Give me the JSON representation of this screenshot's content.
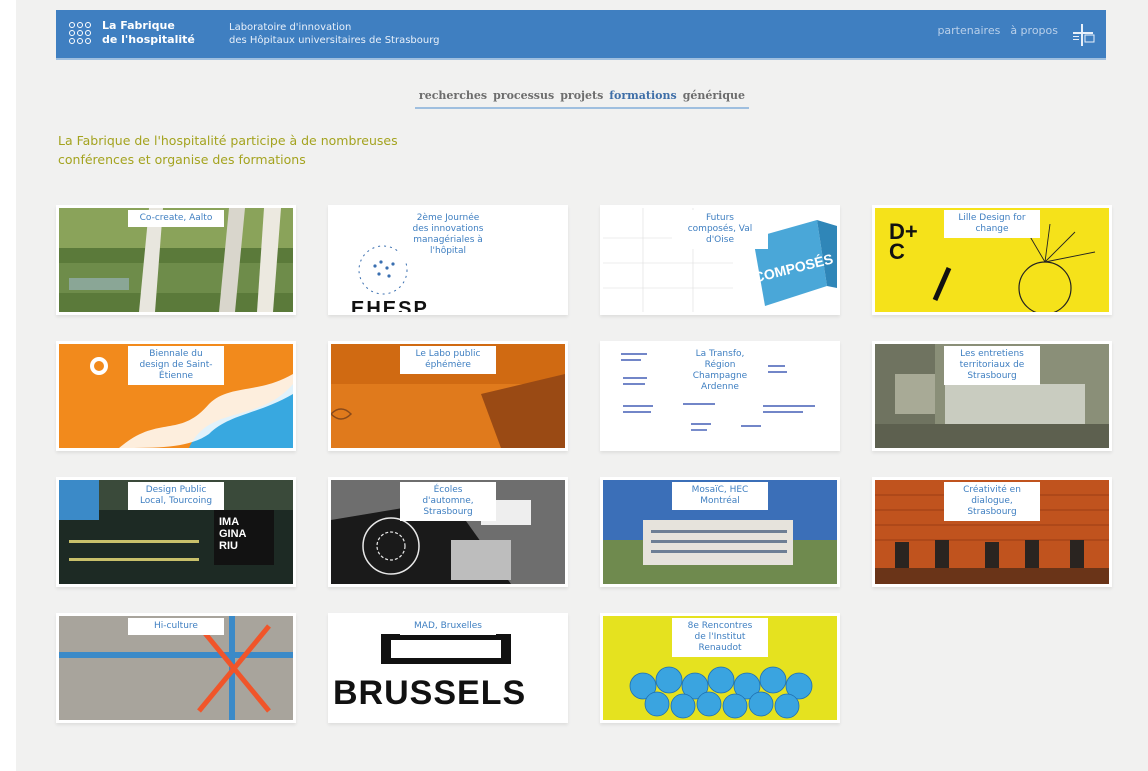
{
  "header": {
    "brand_line1": "La Fabrique",
    "brand_line2": "de l'hospitalité",
    "tagline_line1": "Laboratoire d'innovation",
    "tagline_line2": "des Hôpitaux universitaires de Strasbourg",
    "nav": [
      "partenaires",
      "à propos"
    ],
    "logo_icon": "hus-logo-icon",
    "brand_icon": "fabrique-dots-icon"
  },
  "categories": {
    "items": [
      "recherches",
      "processus",
      "projets",
      "formations",
      "générique"
    ],
    "active": "formations"
  },
  "intro": {
    "line1": "La Fabrique de l'hospitalité participe à de nombreuses",
    "line2": "conférences et organise des formations"
  },
  "cards": [
    {
      "label": "Co-create, Aalto"
    },
    {
      "label": "2ème Journée\ndes innovations\nmanagériales à\nl'hôpital",
      "image_text": "EHESP"
    },
    {
      "label": "Futurs\ncomposés, Val\nd'Oise",
      "image_text": "COMPOSÉS"
    },
    {
      "label": "Lille Design for\nchange",
      "image_text": "D+\nC"
    },
    {
      "label": "Biennale du\ndesign de Saint-\nÉtienne"
    },
    {
      "label": "Le Labo public\néphémère"
    },
    {
      "label": "La Transfo,\nRégion\nChampagne\nArdenne"
    },
    {
      "label": "Les entretiens\nterritoriaux de\nStrasbourg"
    },
    {
      "label": "Design Public\nLocal, Tourcoing",
      "image_text": "IMA\nGINA\nRIU"
    },
    {
      "label": "Écoles\nd'automne,\nStrasbourg"
    },
    {
      "label": "MosaïC, HEC\nMontréal"
    },
    {
      "label": "Créativité en\ndialogue,\nStrasbourg"
    },
    {
      "label": "Hi-culture"
    },
    {
      "label": "MAD, Bruxelles",
      "image_text": "BRUSSELS"
    },
    {
      "label": "8e Rencontres\nde l'Institut\nRenaudot"
    }
  ],
  "colors": {
    "header_blue": "#3f7fc1",
    "intro_olive": "#a4a31f",
    "label_blue": "#3f7fc1",
    "background": "#f1f1f0"
  }
}
